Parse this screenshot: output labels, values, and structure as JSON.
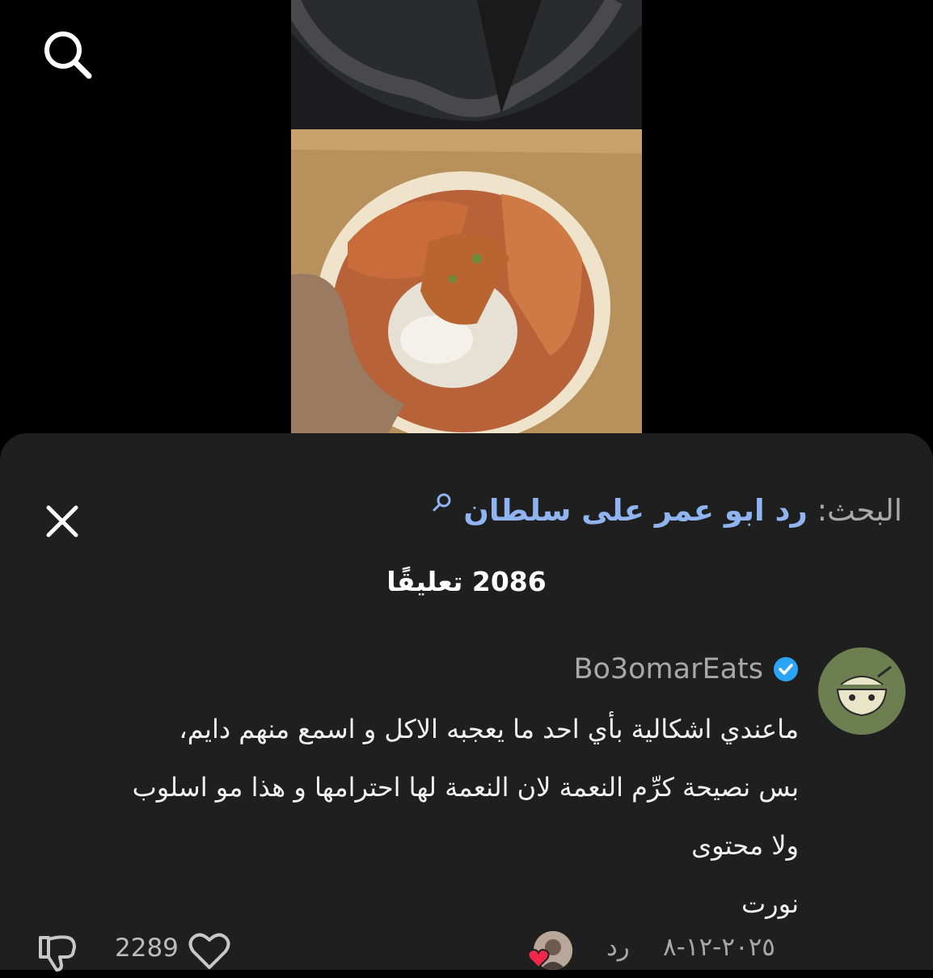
{
  "player": {
    "search_icon": "search-icon",
    "video": "food-bowl-video"
  },
  "sheet": {
    "search_label": "البحث:",
    "search_query": "رد ابو عمر على سلطان",
    "search_query_icon": "search-icon",
    "close_icon": "close-icon",
    "comment_count": "2086 تعليقًا"
  },
  "comment": {
    "author": "Bo3omarEats",
    "verified_icon": "verified-badge-icon",
    "lines": [
      "ماعندي اشكالية بأي احد ما يعجبه الاكل و اسمع منهم دايم،",
      "بس نصيحة كرِّم النعمة لان النعمة لها احترامها و هذا مو اسلوب",
      "ولا محتوى",
      "نورت"
    ],
    "date": "٢٠٢٥-١٢-٨",
    "reply_label": "رد",
    "like_count": "2289",
    "like_icon": "heart-outline-icon",
    "dislike_icon": "thumbs-down-icon"
  },
  "colors": {
    "background": "#000000",
    "sheet": "#1f1f1f",
    "link": "#8fb4ef",
    "verified": "#2aa4f4",
    "muted": "#a8a8a8",
    "heart": "#f0284a"
  }
}
